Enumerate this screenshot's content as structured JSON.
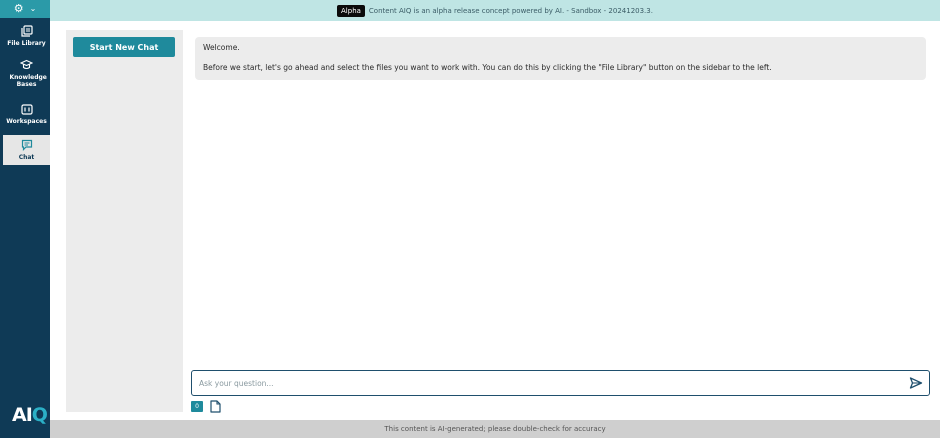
{
  "sidebar": {
    "top_icons": {
      "settings": "gear-icon",
      "toggle": "chevron-down-icon"
    },
    "items": [
      {
        "label": "File Library",
        "icon": "file-library-icon"
      },
      {
        "label": "Knowledge Bases",
        "icon": "graduation-cap-icon"
      },
      {
        "label": "Workspaces",
        "icon": "workspace-icon"
      },
      {
        "label": "Chat",
        "icon": "chat-icon",
        "active": true
      }
    ],
    "logo": {
      "main": "AI",
      "accent": "Q"
    }
  },
  "banner": {
    "badge": "Alpha",
    "text": "Content AIQ is an alpha release concept powered by AI. - Sandbox - 20241203.3."
  },
  "chat_panel": {
    "new_chat_label": "Start New Chat"
  },
  "message": {
    "greeting": "Welcome.",
    "body": "Before we start, let's go ahead and select the files you want to work with. You can do this by clicking the \"File Library\" button on the sidebar to the left."
  },
  "composer": {
    "placeholder": "Ask your question...",
    "file_count": "0",
    "send_icon": "send-icon",
    "file_icon": "document-icon"
  },
  "footer": {
    "text": "This content is AI-generated; please double-check for accuracy"
  },
  "colors": {
    "sidebar": "#0f3a56",
    "accent": "#1f8a9c",
    "banner": "#bfe5e4"
  }
}
